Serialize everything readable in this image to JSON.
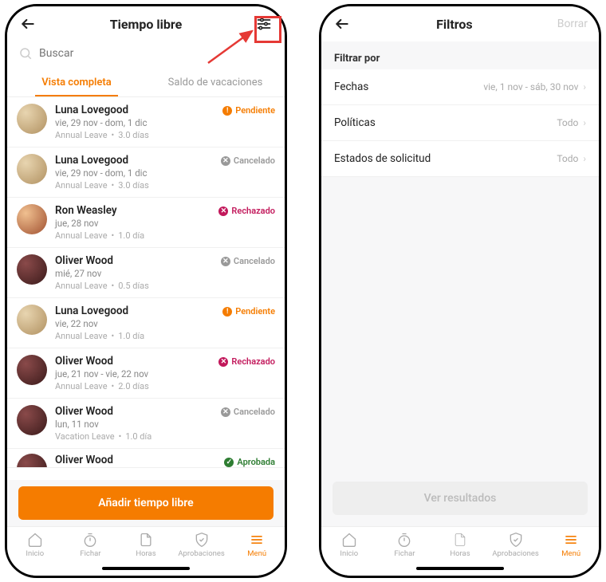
{
  "colors": {
    "accent": "#f57c00",
    "danger": "#c2185b",
    "muted": "#999999",
    "approved": "#2e7d32"
  },
  "left": {
    "header": {
      "title": "Tiempo libre"
    },
    "search": {
      "placeholder": "Buscar"
    },
    "tabs": {
      "full": "Vista completa",
      "balance": "Saldo de vacaciones"
    },
    "add_button": "Añadir tiempo libre",
    "requests": [
      {
        "name": "Luna Lovegood",
        "dates": "vie, 29 nov - dom, 1 dic",
        "policy": "Annual Leave",
        "days": "3.0 días",
        "status_key": "pending",
        "status_label": "Pendiente",
        "avatar": "luna"
      },
      {
        "name": "Luna Lovegood",
        "dates": "vie, 29 nov - dom, 1 dic",
        "policy": "Annual Leave",
        "days": "3.0 días",
        "status_key": "cancelled",
        "status_label": "Cancelado",
        "avatar": "luna"
      },
      {
        "name": "Ron Weasley",
        "dates": "jue, 28 nov",
        "policy": "Annual Leave",
        "days": "1.0 día",
        "status_key": "rejected",
        "status_label": "Rechazado",
        "avatar": "ron"
      },
      {
        "name": "Oliver Wood",
        "dates": "mié, 27 nov",
        "policy": "Annual Leave",
        "days": "0.5 días",
        "status_key": "cancelled",
        "status_label": "Cancelado",
        "avatar": "oliver"
      },
      {
        "name": "Luna Lovegood",
        "dates": "vie, 22 nov",
        "policy": "Annual Leave",
        "days": "1.0 día",
        "status_key": "pending",
        "status_label": "Pendiente",
        "avatar": "luna"
      },
      {
        "name": "Oliver Wood",
        "dates": "jue, 21 nov - vie, 22 nov",
        "policy": "Annual Leave",
        "days": "2.0 días",
        "status_key": "rejected",
        "status_label": "Rechazado",
        "avatar": "oliver"
      },
      {
        "name": "Oliver Wood",
        "dates": "lun, 11 nov",
        "policy": "Vacation Leave",
        "days": "1.0 día",
        "status_key": "cancelled",
        "status_label": "Cancelado",
        "avatar": "oliver"
      },
      {
        "name": "Oliver Wood",
        "dates": "",
        "policy": "",
        "days": "",
        "status_key": "approved",
        "status_label": "Aprobada",
        "avatar": "oliver"
      }
    ]
  },
  "right": {
    "header": {
      "title": "Filtros",
      "clear": "Borrar"
    },
    "section": "Filtrar por",
    "filters": {
      "dates": {
        "label": "Fechas",
        "value": "vie, 1 nov - sáb, 30 nov"
      },
      "policies": {
        "label": "Políticas",
        "value": "Todo"
      },
      "status": {
        "label": "Estados de solicitud",
        "value": "Todo"
      }
    },
    "result_button": "Ver resultados"
  },
  "nav": {
    "home": "Inicio",
    "clock": "Fichar",
    "hours": "Horas",
    "approvals": "Aprobaciones",
    "menu": "Menú"
  },
  "status_icons": {
    "pending": "!",
    "cancelled": "✕",
    "rejected": "✕",
    "approved": "✓"
  }
}
